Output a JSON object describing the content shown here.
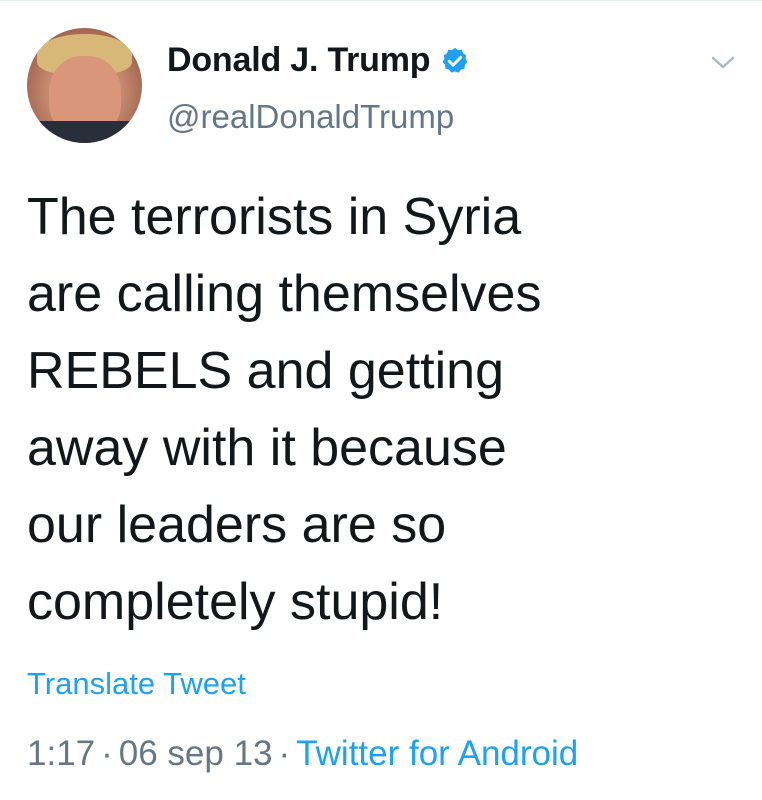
{
  "author": {
    "display_name": "Donald J. Trump",
    "handle": "@realDonaldTrump",
    "verified": true
  },
  "tweet": {
    "text": "The terrorists in Syria\nare calling themselves\nREBELS and getting\naway with it because\nour leaders are so\ncompletely stupid!",
    "translate_label": "Translate Tweet",
    "time": "1:17",
    "separator": "·",
    "date": "06 sep 13",
    "source": "Twitter for Android"
  },
  "icons": {
    "verified": "verified-badge-icon",
    "menu": "chevron-down-icon"
  },
  "colors": {
    "accent": "#1da1f2",
    "text": "#14171a",
    "secondary": "#657786"
  }
}
